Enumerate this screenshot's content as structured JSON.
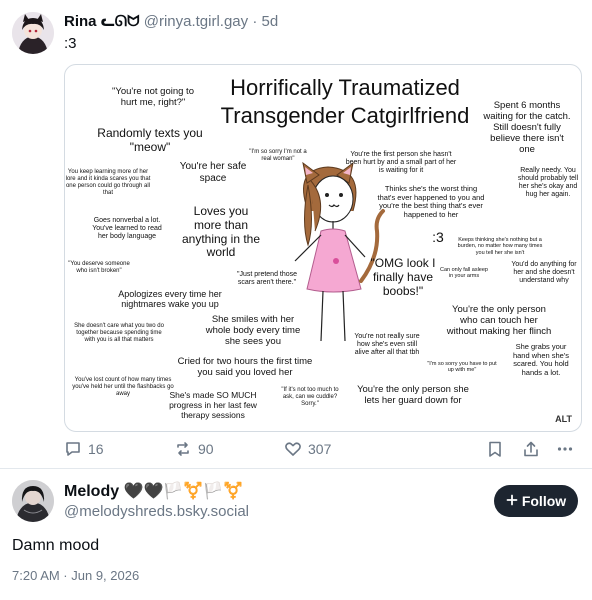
{
  "quoted_post": {
    "author_name": "Rina ᓚᘏᗢ",
    "handle": "@rinya.tgirl.gay",
    "separator": " · ",
    "time_ago": "5d",
    "text": ":3",
    "image": {
      "title_line1": "Horrifically Traumatized",
      "title_line2": "Transgender Catgirlfriend",
      "alt_badge": "ALT",
      "snippets": [
        "\"You're not going to hurt me, right?\"",
        "Randomly texts you \"meow\"",
        "You're her safe space",
        "\"I'm so sorry I'm not a real woman\"",
        "You're the first person she hasn't been hurt by and a small part of her is waiting for it",
        "Spent 6 months waiting for the catch. Still doesn't fully believe there isn't one",
        "You keep learning more of her lore and it kinda scares you that one person could go through all that",
        "Really needy. You should probably tell her she's okay and hug her again.",
        "Thinks she's the worst thing that's ever happened to you and you're the best thing that's ever happened to her",
        "Goes nonverbal a lot. You've learned to read her body language",
        "Loves you more than anything in the world",
        ":3",
        "Keeps thinking she's nothing but a burden, no matter how many times you tell her she isn't",
        "\"You deserve someone who isn't broken\"",
        "\"Just pretend those scars aren't there.\"",
        "Can only fall asleep in your arms",
        "You'd do anything for her and she doesn't understand why",
        "Apologizes every time her nightmares wake you up",
        "\"OMG look I finally have boobs!\"",
        "You're the only person who can touch her without making her flinch",
        "She doesn't care what you two do together because spending time with you is all that matters",
        "She smiles with her whole body every time she sees you",
        "You're not really sure how she's even still alive after all that tbh",
        "She grabs your hand when she's scared. You hold hands a lot.",
        "\"I'm so sorry you have to put up with me\"",
        "Cried for two hours the first time you said you loved her",
        "You've lost count of how many times you've held her until the flashbacks go away",
        "She's made SO MUCH progress in her last few therapy sessions",
        "\"If it's not too much to ask, can we cuddle? Sorry.\"",
        "You're the only person she lets her guard down for"
      ]
    },
    "actions": {
      "replies": "16",
      "reposts": "90",
      "likes": "307"
    }
  },
  "main_post": {
    "author_name": "Melody 🖤🖤🏳️⚧️🏳️⚧️",
    "handle": "@melodyshreds.bsky.social",
    "follow_label": "Follow",
    "text": "Damn mood",
    "timestamp": "7:20 AM · Jun 9, 2026"
  },
  "colors": {
    "muted": "#6b7785",
    "follow_bg": "#1d2530",
    "border": "#d4dbe2"
  }
}
